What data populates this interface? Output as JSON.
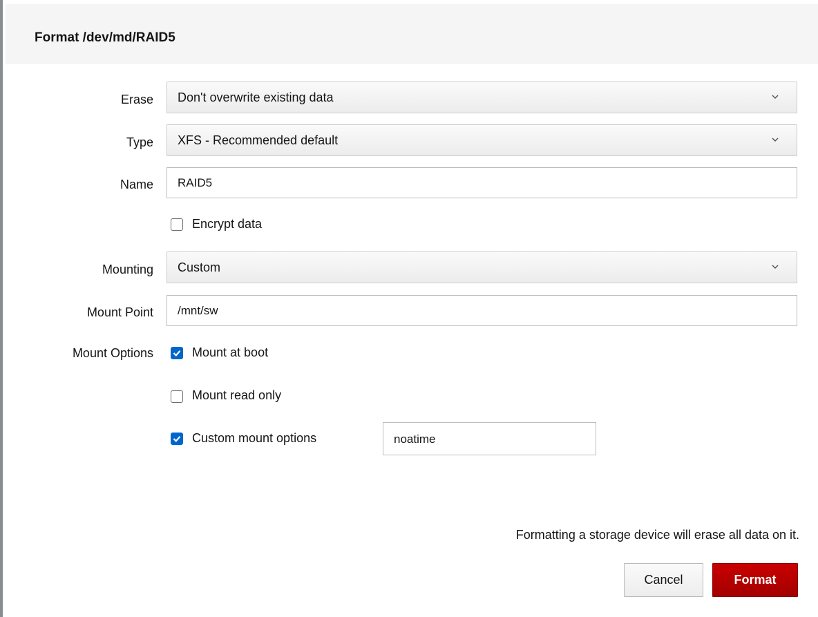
{
  "dialog": {
    "title": "Format /dev/md/RAID5"
  },
  "form": {
    "erase": {
      "label": "Erase",
      "value": "Don't overwrite existing data"
    },
    "type": {
      "label": "Type",
      "value": "XFS - Recommended default"
    },
    "name": {
      "label": "Name",
      "value": "RAID5"
    },
    "encrypt": {
      "label": "Encrypt data",
      "checked": false
    },
    "mounting": {
      "label": "Mounting",
      "value": "Custom"
    },
    "mount_point": {
      "label": "Mount Point",
      "value": "/mnt/sw"
    },
    "mount_options": {
      "label": "Mount Options",
      "boot": {
        "label": "Mount at boot",
        "checked": true
      },
      "read_only": {
        "label": "Mount read only",
        "checked": false
      },
      "custom": {
        "label": "Custom mount options",
        "checked": true,
        "value": "noatime"
      }
    }
  },
  "footer": {
    "warning": "Formatting a storage device will erase all data on it.",
    "cancel_label": "Cancel",
    "format_label": "Format"
  },
  "colors": {
    "accent": "#0066cc",
    "danger": "#c00000",
    "header_bg": "#f5f5f5"
  },
  "icons": {
    "select_caret": "chevron-down-icon",
    "checkbox_mark": "checkmark-icon"
  }
}
